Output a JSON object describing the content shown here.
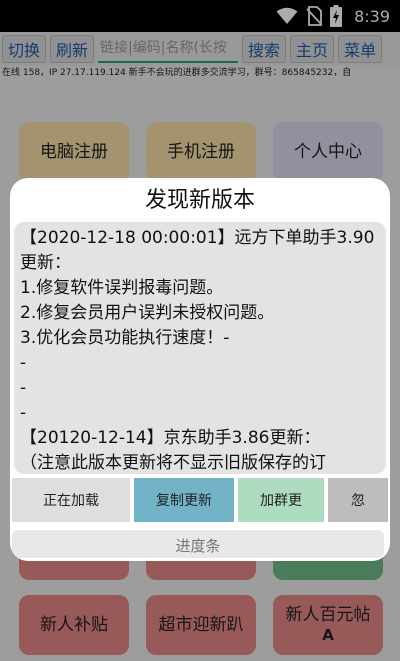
{
  "status_bar": {
    "time": "8:39",
    "icons": [
      "wifi-icon",
      "no-sim-icon",
      "battery-charging-icon"
    ],
    "color": "#000000"
  },
  "toolbar": {
    "switch_label": "切换",
    "refresh_label": "刷新",
    "input_placeholder": "链接|编码|名称(长按",
    "search_label": "搜索",
    "home_label": "主页",
    "menu_label": "菜单",
    "text_color": "#1e5aa8"
  },
  "ticker": {
    "text": "在线 158，IP 27.17.119.124 新手不会玩的进群多交流学习，群号：865845232，自"
  },
  "tiles": [
    {
      "label": "电脑注册",
      "sub": "",
      "color": "#f3dca4"
    },
    {
      "label": "手机注册",
      "sub": "",
      "color": "#f3dca4"
    },
    {
      "label": "个人中心",
      "sub": "",
      "color": "#ddd6ee"
    },
    {
      "label": "",
      "sub": "",
      "color": "#e38585"
    },
    {
      "label": "",
      "sub": "",
      "color": "#e38585"
    },
    {
      "label": "",
      "sub": "",
      "color": "#6fba86"
    },
    {
      "label": "新人补贴",
      "sub": "",
      "color": "#e38585"
    },
    {
      "label": "超市迎新趴",
      "sub": "",
      "color": "#e38585"
    },
    {
      "label": "新人百元帖",
      "sub": "A",
      "color": "#e38585"
    }
  ],
  "dialog": {
    "title": "发现新版本",
    "lines": [
      "【2020-12-18 00:00:01】远方下单助手3.90更新：",
      "1.修复软件误判报毒问题。",
      "2.修复会员用户误判未授权问题。",
      "3.优化会员功能执行速度！-",
      "-",
      "-",
      "-",
      "【20120-12-14】京东助手3.86更新：",
      "（注意此版本更新将不显示旧版保存的订"
    ],
    "buttons": [
      {
        "label": "正在加载",
        "color": "#dedede"
      },
      {
        "label": "复制更新",
        "color": "#73b3c8"
      },
      {
        "label": "加群更",
        "color": "#aedcc0"
      },
      {
        "label": "忽",
        "color": "#bdbdbd"
      }
    ],
    "progress_label": "进度条"
  }
}
